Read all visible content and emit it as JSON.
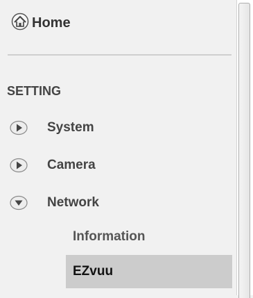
{
  "home": {
    "label": "Home",
    "icon": "home-icon"
  },
  "setting": {
    "title": "SETTING",
    "items": [
      {
        "label": "System",
        "icon": "arrow-right-icon",
        "expanded": false
      },
      {
        "label": "Camera",
        "icon": "arrow-right-icon",
        "expanded": false
      },
      {
        "label": "Network",
        "icon": "arrow-down-icon",
        "expanded": true
      }
    ],
    "network_subitems": [
      {
        "label": "Information",
        "selected": false
      },
      {
        "label": "EZvuu",
        "selected": true
      }
    ]
  },
  "colors": {
    "background": "#f1f1f1",
    "selected_background": "#cccccc",
    "text": "#333333"
  }
}
